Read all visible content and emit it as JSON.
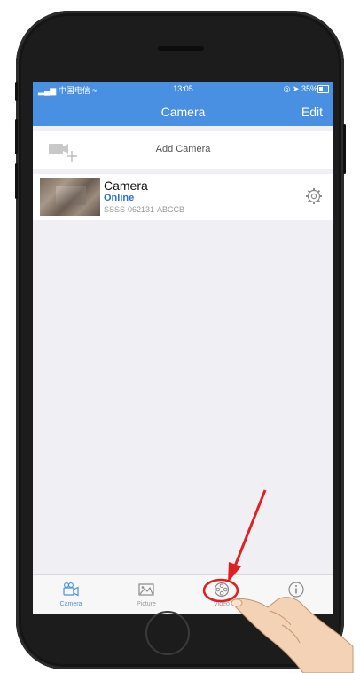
{
  "status_bar": {
    "carrier": "中国电信",
    "time": "13:05",
    "battery": "35%"
  },
  "nav": {
    "title": "Camera",
    "edit_label": "Edit"
  },
  "add_camera": {
    "label": "Add Camera"
  },
  "camera_list": [
    {
      "name": "Camera",
      "status": "Online",
      "uid": "SSSS-062131-ABCCB"
    }
  ],
  "tabs": [
    {
      "label": "Camera",
      "icon": "video-camera-icon",
      "active": true
    },
    {
      "label": "Picture",
      "icon": "picture-icon",
      "active": false
    },
    {
      "label": "Video",
      "icon": "film-reel-icon",
      "active": false
    },
    {
      "label": "",
      "icon": "info-icon",
      "active": false
    }
  ],
  "colors": {
    "accent": "#4a90e2",
    "online": "#2a6fd1",
    "highlight": "#e02020"
  }
}
